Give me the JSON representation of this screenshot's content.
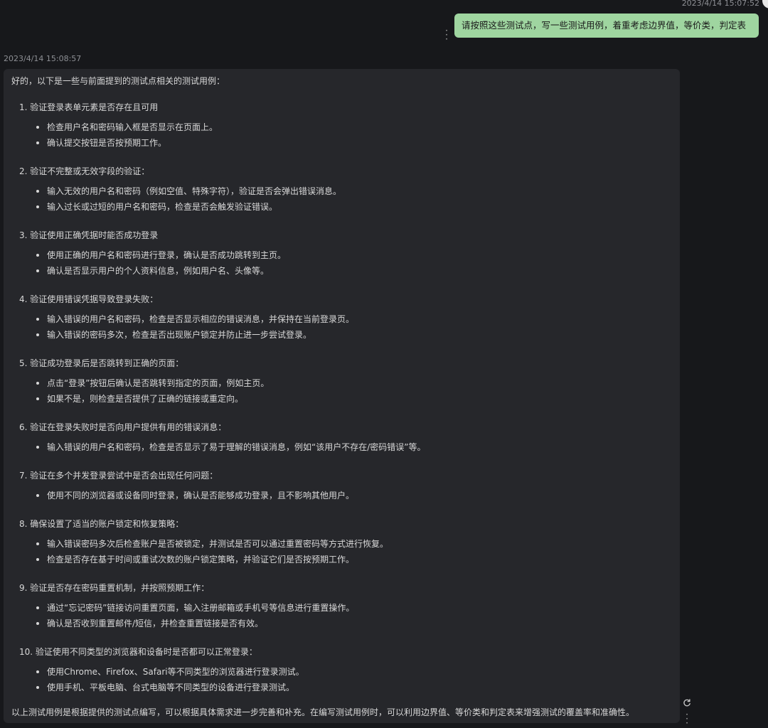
{
  "user_message": {
    "timestamp": "2023/4/14 15:07:52",
    "text": "请按照这些测试点，写一些测试用例，着重考虑边界值，等价类，判定表"
  },
  "assistant_message": {
    "timestamp": "2023/4/14 15:08:57",
    "intro": "好的，以下是一些与前面提到的测试点相关的测试用例：",
    "sections": [
      {
        "number": "1.",
        "title": "验证登录表单元素是否存在且可用",
        "bullets": [
          "检查用户名和密码输入框是否显示在页面上。",
          "确认提交按钮是否按预期工作。"
        ]
      },
      {
        "number": "2.",
        "title": "验证不完整或无效字段的验证：",
        "bullets": [
          "输入无效的用户名和密码（例如空值、特殊字符），验证是否会弹出错误消息。",
          "输入过长或过短的用户名和密码，检查是否会触发验证错误。"
        ]
      },
      {
        "number": "3.",
        "title": "验证使用正确凭据时能否成功登录",
        "bullets": [
          "使用正确的用户名和密码进行登录，确认是否成功跳转到主页。",
          "确认是否显示用户的个人资料信息，例如用户名、头像等。"
        ]
      },
      {
        "number": "4.",
        "title": "验证使用错误凭据导致登录失败：",
        "bullets": [
          "输入错误的用户名和密码，检查是否显示相应的错误消息，并保持在当前登录页。",
          "输入错误的密码多次，检查是否出现账户锁定并防止进一步尝试登录。"
        ]
      },
      {
        "number": "5.",
        "title": "验证成功登录后是否跳转到正确的页面：",
        "bullets": [
          "点击“登录”按钮后确认是否跳转到指定的页面，例如主页。",
          "如果不是，则检查是否提供了正确的链接或重定向。"
        ]
      },
      {
        "number": "6.",
        "title": "验证在登录失败时是否向用户提供有用的错误消息：",
        "bullets": [
          "输入错误的用户名和密码，检查是否显示了易于理解的错误消息，例如“该用户不存在/密码错误”等。"
        ]
      },
      {
        "number": "7.",
        "title": "验证在多个并发登录尝试中是否会出现任何问题：",
        "bullets": [
          "使用不同的浏览器或设备同时登录，确认是否能够成功登录，且不影响其他用户。"
        ]
      },
      {
        "number": "8.",
        "title": "确保设置了适当的账户锁定和恢复策略：",
        "bullets": [
          "输入错误密码多次后检查账户是否被锁定，并测试是否可以通过重置密码等方式进行恢复。",
          "检查是否存在基于时间或重试次数的账户锁定策略，并验证它们是否按预期工作。"
        ]
      },
      {
        "number": "9.",
        "title": "验证是否存在密码重置机制，并按照预期工作：",
        "bullets": [
          "通过“忘记密码”链接访问重置页面，输入注册邮箱或手机号等信息进行重置操作。",
          "确认是否收到重置邮件/短信，并检查重置链接是否有效。"
        ]
      },
      {
        "number": "10.",
        "title": "验证使用不同类型的浏览器和设备时是否都可以正常登录：",
        "bullets": [
          "使用Chrome、Firefox、Safari等不同类型的浏览器进行登录测试。",
          "使用手机、平板电脑、台式电脑等不同类型的设备进行登录测试。"
        ]
      }
    ],
    "outro": "以上测试用例是根据提供的测试点编写，可以根据具体需求进一步完善和补充。在编写测试用例时，可以利用边界值、等价类和判定表来增强测试的覆盖率和准确性。"
  },
  "icons": {
    "user_more": "more-vertical-icon",
    "refresh": "refresh-icon",
    "bot_more": "more-vertical-icon"
  },
  "colors": {
    "background": "#17181b",
    "user_bubble": "#9fd5a0",
    "assistant_bubble": "#26272b"
  }
}
